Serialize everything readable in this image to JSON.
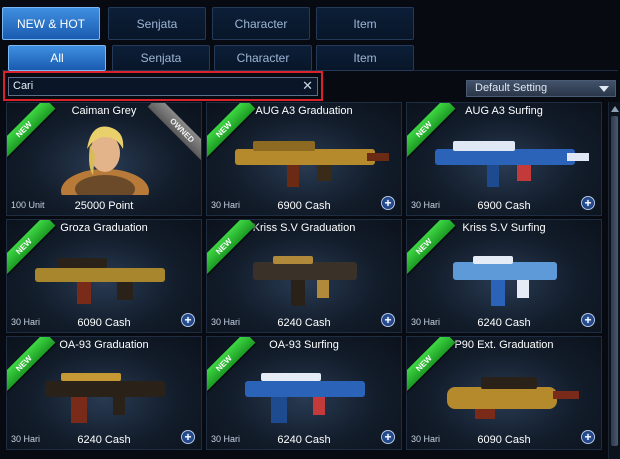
{
  "tabs": [
    "NEW & HOT",
    "Senjata",
    "Character",
    "Item"
  ],
  "subtabs": [
    "All",
    "Senjata",
    "Character",
    "Item"
  ],
  "search": {
    "value": "Cari"
  },
  "sort": {
    "selected": "Default Setting"
  },
  "colors": {
    "accent": "#2f7fd6",
    "new_badge": "#2fbf35",
    "highlight": "#d9232c"
  },
  "items": [
    {
      "title": "Caiman Grey",
      "price": "25000 Point",
      "duration": "100 Unit",
      "badge": "NEW",
      "owned": "OWNED",
      "icon": "character-portrait"
    },
    {
      "title": "AUG A3 Graduation",
      "price": "6900 Cash",
      "duration": "30 Hari",
      "badge": "NEW",
      "icon": "rifle"
    },
    {
      "title": "AUG A3 Surfing",
      "price": "6900 Cash",
      "duration": "30 Hari",
      "badge": "NEW",
      "icon": "rifle"
    },
    {
      "title": "Groza Graduation",
      "price": "6090 Cash",
      "duration": "30 Hari",
      "badge": "NEW",
      "icon": "rifle"
    },
    {
      "title": "Kriss S.V Graduation",
      "price": "6240 Cash",
      "duration": "30 Hari",
      "badge": "NEW",
      "icon": "smg"
    },
    {
      "title": "Kriss S.V Surfing",
      "price": "6240 Cash",
      "duration": "30 Hari",
      "badge": "NEW",
      "icon": "smg"
    },
    {
      "title": "OA-93 Graduation",
      "price": "6240 Cash",
      "duration": "30 Hari",
      "badge": "NEW",
      "icon": "smg"
    },
    {
      "title": "OA-93 Surfing",
      "price": "6240 Cash",
      "duration": "30 Hari",
      "badge": "NEW",
      "icon": "smg"
    },
    {
      "title": "P90 Ext. Graduation",
      "price": "6090 Cash",
      "duration": "30 Hari",
      "badge": "NEW",
      "icon": "smg"
    }
  ]
}
